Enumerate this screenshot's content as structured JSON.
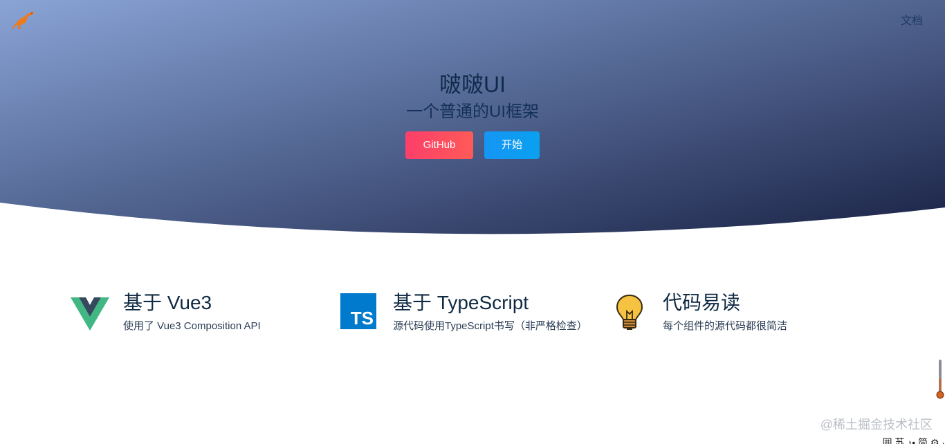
{
  "nav": {
    "logo_icon": "kangaroo-icon",
    "docs_label": "文档"
  },
  "hero": {
    "title": "啵啵UI",
    "subtitle": "一个普通的UI框架",
    "buttons": {
      "github_label": "GitHub",
      "start_label": "开始"
    },
    "colors": {
      "gradient_start": "#7f9ccb",
      "gradient_end": "#1c2547",
      "github_button": "#fc3f6a",
      "start_button": "#1596f5"
    }
  },
  "features": [
    {
      "icon": "vue-logo-icon",
      "title": "基于 Vue3",
      "description": "使用了 Vue3 Composition API"
    },
    {
      "icon": "typescript-logo-icon",
      "icon_text": "TS",
      "title": "基于 TypeScript",
      "description": "源代码使用TypeScript书写（非严格检查）"
    },
    {
      "icon": "lightbulb-icon",
      "title": "代码易读",
      "description": "每个组件的源代码都很简洁"
    }
  ],
  "watermark": "@稀土掘金技术社区",
  "bottom_strip": "囲 苏 ♪• 简 ⚙ ·"
}
